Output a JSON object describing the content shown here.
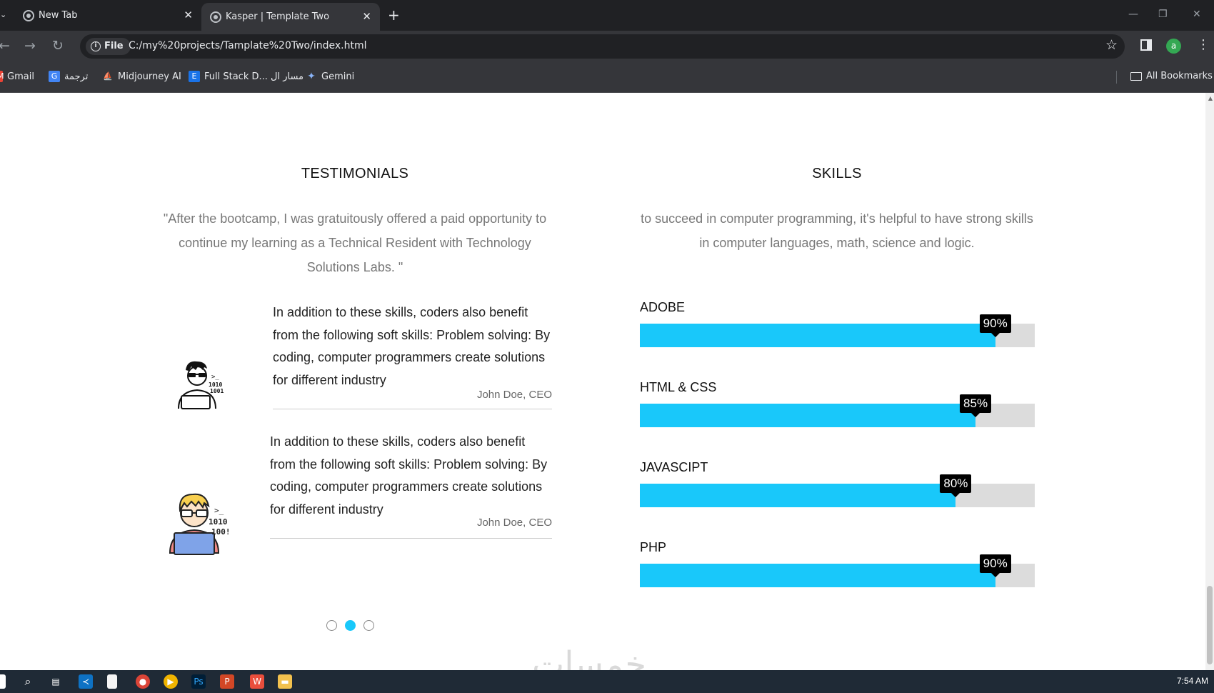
{
  "browser": {
    "tabs": [
      {
        "title": "New Tab",
        "active": false
      },
      {
        "title": "Kasper | Template Two",
        "active": true
      }
    ],
    "address": {
      "chip": "File",
      "url": "C:/my%20projects/Tamplate%20Two/index.html"
    },
    "profile_initial": "a",
    "bookmarks": [
      {
        "label": "Gmail",
        "icon": "gmail-icon",
        "color": "#ea4335"
      },
      {
        "label": "ترجمة",
        "icon": "translate-icon",
        "color": "#4285f4"
      },
      {
        "label": "Midjourney AI",
        "icon": "midjourney-icon",
        "color": "#9aa0a6"
      },
      {
        "label": "Full Stack D... مسار ال",
        "icon": "elzero-icon",
        "color": "#1a73e8"
      },
      {
        "label": "Gemini",
        "icon": "gemini-icon",
        "color": "#8ab4f8"
      }
    ],
    "all_bookmarks": "All Bookmarks"
  },
  "testimonials": {
    "title": "TESTIMONIALS",
    "subtitle": "\"After the bootcamp, I was gratuitously offered a paid opportunity to continue my learning as a Technical Resident with Technology Solutions Labs. \"",
    "reviews": [
      {
        "text": "In addition to these skills, coders also benefit from the following soft skills: Problem solving: By coding, computer programmers create solutions for different industry",
        "author": "John Doe, CEO"
      },
      {
        "text": "In addition to these skills, coders also benefit from the following soft skills: Problem solving: By coding, computer programmers create solutions for different industry",
        "author": "John Doe, CEO"
      }
    ],
    "active_dot": 1
  },
  "skills": {
    "title": "SKILLS",
    "subtitle": "to succeed in computer programming, it's helpful to have strong skills in computer languages, math, science and logic.",
    "items": [
      {
        "name": "ADOBE",
        "percent": 90,
        "label": "90%"
      },
      {
        "name": "HTML & CSS",
        "percent": 85,
        "label": "85%"
      },
      {
        "name": "JAVASCIPT",
        "percent": 80,
        "label": "80%"
      },
      {
        "name": "PHP",
        "percent": 90,
        "label": "90%"
      }
    ]
  },
  "watermark": "خمسات",
  "taskbar": {
    "clock": "7:54 AM"
  },
  "colors": {
    "accent": "#19c8fa",
    "track": "#dcdcdc"
  }
}
